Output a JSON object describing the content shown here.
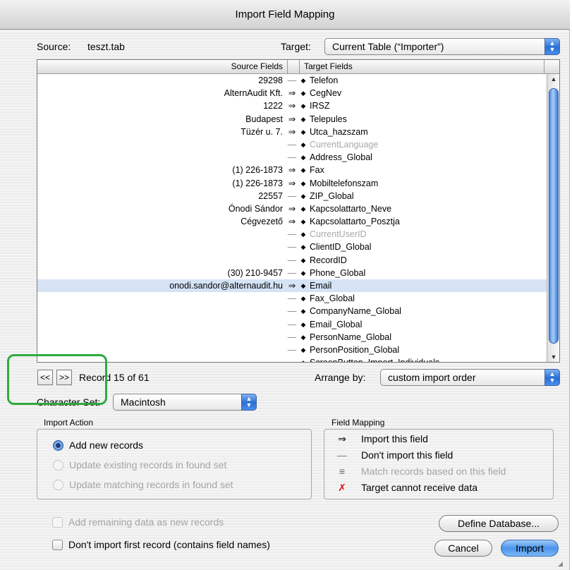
{
  "window": {
    "title": "Import Field Mapping"
  },
  "source": {
    "label": "Source:",
    "value": "teszt.tab"
  },
  "target": {
    "label": "Target:",
    "value": "Current Table (“Importer”)"
  },
  "list": {
    "header_source": "Source Fields",
    "header_target": "Target Fields",
    "rows": [
      {
        "source": "29298",
        "arrow": "—",
        "target": "Telefon",
        "dim": false
      },
      {
        "source": "AlternAudit Kft.",
        "arrow": "⇒",
        "target": "CegNev",
        "dim": false
      },
      {
        "source": "1222",
        "arrow": "⇒",
        "target": "IRSZ",
        "dim": false
      },
      {
        "source": "Budapest",
        "arrow": "⇒",
        "target": "Telepules",
        "dim": false
      },
      {
        "source": "Tüzér u. 7.",
        "arrow": "⇒",
        "target": "Utca_hazszam",
        "dim": false
      },
      {
        "source": "",
        "arrow": "—",
        "target": "CurrentLanguage",
        "dim": true
      },
      {
        "source": "",
        "arrow": "—",
        "target": "Address_Global",
        "dim": false
      },
      {
        "source": "(1) 226-1873",
        "arrow": "⇒",
        "target": "Fax",
        "dim": false
      },
      {
        "source": "(1) 226-1873",
        "arrow": "⇒",
        "target": "Mobiltelefonszam",
        "dim": false
      },
      {
        "source": "22557",
        "arrow": "—",
        "target": "ZIP_Global",
        "dim": false
      },
      {
        "source": "Ónodi Sándor",
        "arrow": "⇒",
        "target": "Kapcsolattarto_Neve",
        "dim": false
      },
      {
        "source": "Cégvezető",
        "arrow": "⇒",
        "target": "Kapcsolattarto_Posztja",
        "dim": false
      },
      {
        "source": "",
        "arrow": "—",
        "target": "CurrentUserID",
        "dim": true
      },
      {
        "source": "",
        "arrow": "—",
        "target": "ClientID_Global",
        "dim": false
      },
      {
        "source": "",
        "arrow": "—",
        "target": "RecordID",
        "dim": false
      },
      {
        "source": "(30) 210-9457",
        "arrow": "—",
        "target": "Phone_Global",
        "dim": false
      },
      {
        "source": "onodi.sandor@alternaudit.hu",
        "arrow": "⇒",
        "target": "Email",
        "dim": false,
        "selected": true
      },
      {
        "source": "",
        "arrow": "—",
        "target": "Fax_Global",
        "dim": false
      },
      {
        "source": "",
        "arrow": "—",
        "target": "CompanyName_Global",
        "dim": false
      },
      {
        "source": "",
        "arrow": "—",
        "target": "Email_Global",
        "dim": false
      },
      {
        "source": "",
        "arrow": "—",
        "target": "PersonName_Global",
        "dim": false
      },
      {
        "source": "",
        "arrow": "—",
        "target": "PersonPosition_Global",
        "dim": false
      },
      {
        "source": "",
        "arrow": "—",
        "target": "ScreenButton_Import_Individuals",
        "dim": false
      }
    ]
  },
  "navigation": {
    "prev": "<<",
    "next": ">>",
    "record_text": "Record 15 of 61"
  },
  "arrange": {
    "label": "Arrange by:",
    "value": "custom import order"
  },
  "charset": {
    "label": "Character Set:",
    "value": "Macintosh"
  },
  "import_action": {
    "title": "Import Action",
    "options": [
      {
        "label": "Add new records",
        "selected": true,
        "enabled": true
      },
      {
        "label": "Update existing records in found set",
        "selected": false,
        "enabled": false
      },
      {
        "label": "Update matching records in found set",
        "selected": false,
        "enabled": false
      }
    ]
  },
  "field_mapping": {
    "title": "Field Mapping",
    "items": [
      {
        "symbol": "⇒",
        "label": "Import this field",
        "enabled": true
      },
      {
        "symbol": "—",
        "label": "Don't import this field",
        "enabled": true
      },
      {
        "symbol": "≡",
        "label": "Match records based on this field",
        "enabled": false
      },
      {
        "symbol": "✗",
        "label": "Target cannot receive data",
        "enabled": true
      }
    ]
  },
  "options": {
    "add_remaining": "Add remaining data as new records",
    "dont_import_first": "Don't import first record (contains field names)"
  },
  "buttons": {
    "define_db": "Define Database...",
    "cancel": "Cancel",
    "import": "Import"
  },
  "colors": {
    "accent": "#3b78d4",
    "highlight_box": "#2eaa3f",
    "selection": "#d5e3f5"
  }
}
